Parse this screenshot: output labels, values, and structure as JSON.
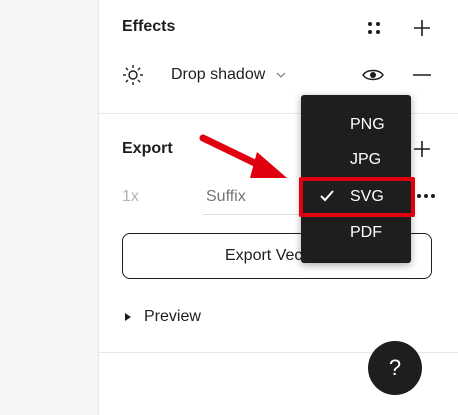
{
  "effects": {
    "title": "Effects",
    "item": {
      "label": "Drop shadow",
      "icon": "sun-icon",
      "visibility_icon": "eye-icon",
      "remove_icon": "minus-icon"
    },
    "style_icon": "dots-grid-icon",
    "add_icon": "plus-icon"
  },
  "export": {
    "title": "Export",
    "scale_value": "1x",
    "suffix_placeholder": "Suffix",
    "more_icon": "more-icon",
    "add_icon": "plus-icon",
    "button_label": "Export Vector",
    "preview_label": "Preview",
    "format_menu": {
      "options": [
        "PNG",
        "JPG",
        "SVG",
        "PDF"
      ],
      "selected": "SVG"
    }
  },
  "help": {
    "label": "?"
  },
  "colors": {
    "accent": "#e00010",
    "menu_bg": "#1e1e1e",
    "text": "#1e1e1e",
    "muted": "#b3b3b3"
  }
}
